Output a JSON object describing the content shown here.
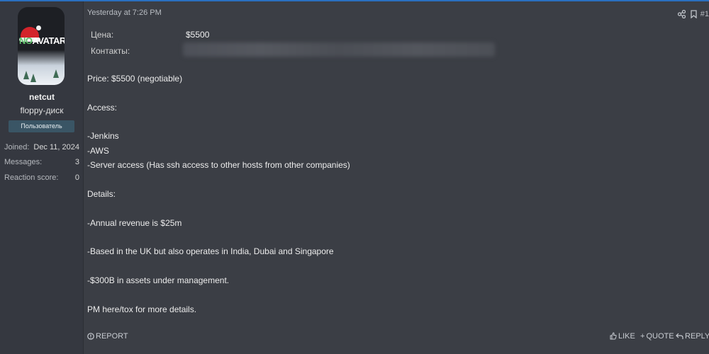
{
  "user": {
    "avatar_text_no": "NO",
    "avatar_text_rest": "AVATAR",
    "name": "netcut",
    "title": "floppy-диск",
    "role": "Пользователь",
    "stats": [
      {
        "label": "Joined:",
        "value": "Dec 11, 2024"
      },
      {
        "label": "Messages:",
        "value": "3"
      },
      {
        "label": "Reaction score:",
        "value": "0"
      }
    ]
  },
  "post": {
    "timestamp": "Yesterday at 7:26 PM",
    "number": "#1",
    "fields": [
      {
        "label": "Цена:",
        "value": "$5500"
      },
      {
        "label": "Контакты:",
        "value": ""
      }
    ],
    "lines": [
      "Price: $5500 (negotiable)",
      "Access:",
      "-Jenkins",
      "-AWS",
      "-Server access (Has ssh access to other hosts from other companies)",
      "Details:",
      "-Annual revenue is $25m",
      "-Based in the UK but also operates in India, Dubai and Singapore",
      "-$300B in assets under management.",
      "PM here/tox for more details."
    ]
  },
  "footer": {
    "report": "REPORT",
    "like": "LIKE",
    "quote": "QUOTE",
    "reply": "REPLY"
  },
  "icons": {
    "share": "share-icon",
    "bookmark": "bookmark-icon",
    "report": "report-icon",
    "like": "like-icon",
    "quote": "quote-icon",
    "reply": "reply-icon"
  },
  "colors": {
    "background": "#3b3e45",
    "panel": "#353840",
    "accent": "#2a6fbf",
    "badge": "#3a5565"
  }
}
